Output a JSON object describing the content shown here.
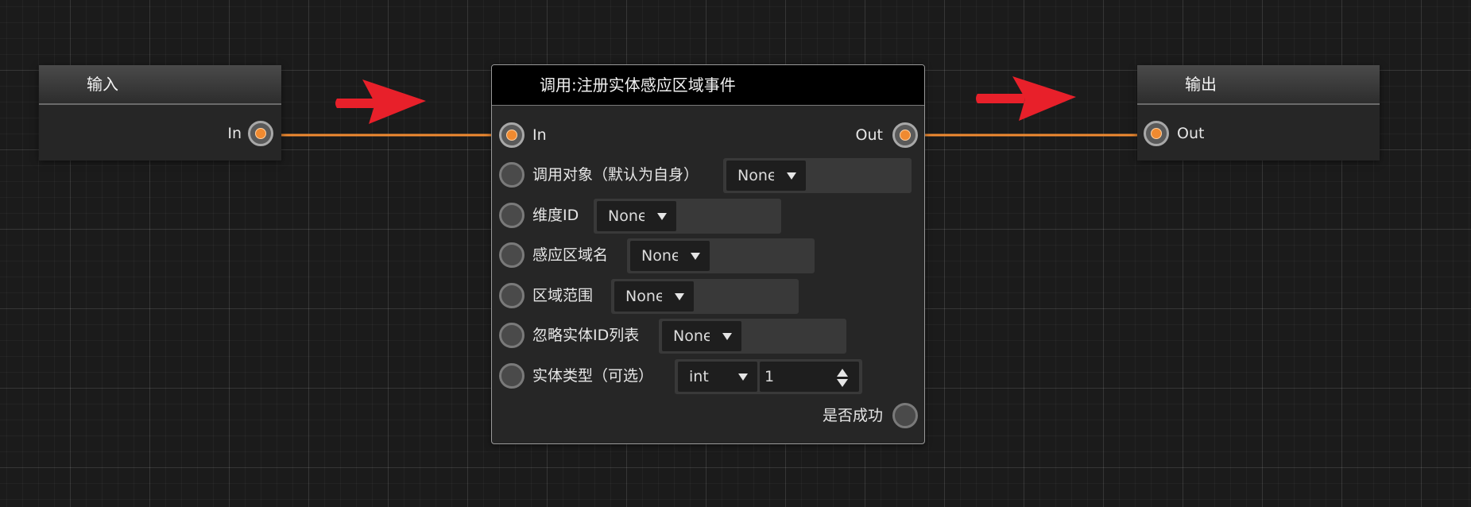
{
  "colors": {
    "wire": "#f08a30",
    "arrow": "#e8202a",
    "grid_background": "#1b1b1b",
    "node_body": "#262626",
    "main_header": "#000000"
  },
  "input_node": {
    "title": "输入",
    "pin_in_label": "In"
  },
  "output_node": {
    "title": "输出",
    "pin_out_label": "Out"
  },
  "main_node": {
    "title": "调用:注册实体感应区域事件",
    "exec_in_label": "In",
    "exec_out_label": "Out",
    "params": [
      {
        "label": "调用对象（默认为自身）",
        "value": "None"
      },
      {
        "label": "维度ID",
        "value": "None"
      },
      {
        "label": "感应区域名",
        "value": "None"
      },
      {
        "label": "区域范围",
        "value": "None"
      },
      {
        "label": "忽略实体ID列表",
        "value": "None"
      },
      {
        "label": "实体类型（可选）",
        "type_value": "int",
        "number_value": "1"
      }
    ],
    "success_output_label": "是否成功"
  }
}
